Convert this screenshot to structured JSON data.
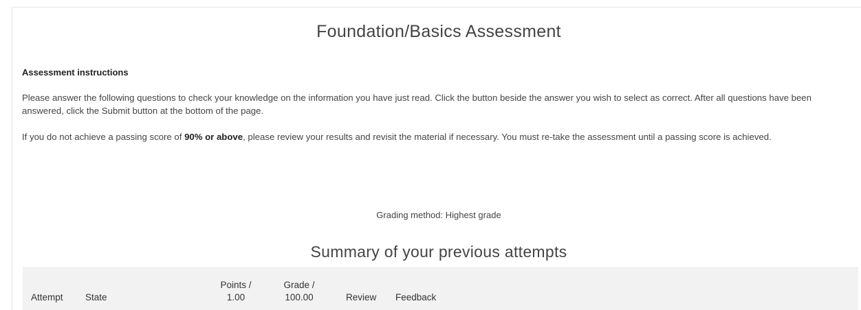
{
  "page": {
    "title": "Foundation/Basics Assessment"
  },
  "instructions": {
    "heading": "Assessment instructions",
    "paragraph1": "Please answer the following questions to check your knowledge on the information you have just read. Click the button beside the answer you wish to select as correct. After all questions have been answered, click the Submit button at the bottom of the page.",
    "paragraph2_before": "If you do not achieve a passing score of ",
    "paragraph2_bold": "90% or above",
    "paragraph2_after": ", please review your results and revisit the material if necessary. You must re-take the assessment until a passing score is achieved."
  },
  "grading": {
    "method_text": "Grading method: Highest grade"
  },
  "summary": {
    "title": "Summary of your previous attempts",
    "columns": {
      "attempt": "Attempt",
      "state": "State",
      "points_line1": "Points /",
      "points_line2": "1.00",
      "grade_line1": "Grade /",
      "grade_line2": "100.00",
      "review": "Review",
      "feedback": "Feedback"
    }
  }
}
